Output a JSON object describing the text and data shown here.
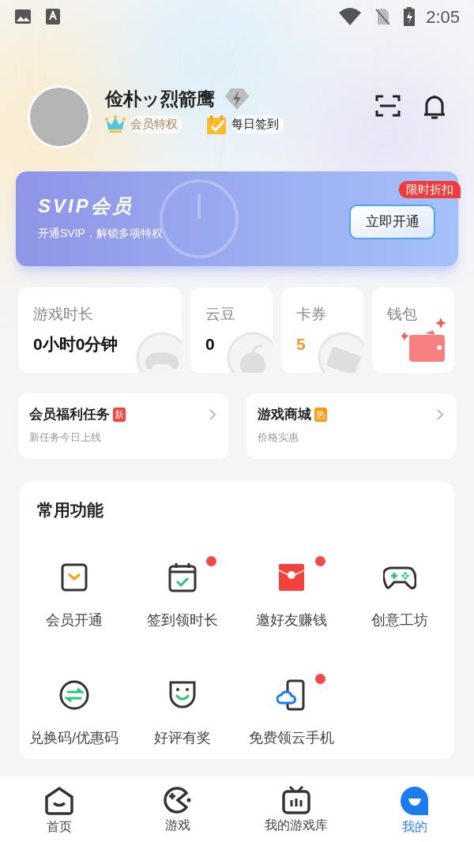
{
  "status_bar": {
    "time": "2:05"
  },
  "profile": {
    "username": "俭朴ッ烈箭鹰",
    "badges": [
      {
        "label": "会员特权"
      },
      {
        "label": "每日签到"
      }
    ]
  },
  "svip_banner": {
    "title": "SVIP会员",
    "subtitle": "开通SVIP，解锁多项特权",
    "tag": "限时折扣",
    "button": "立即开通"
  },
  "stats": [
    {
      "kind": "value",
      "label": "游戏时长",
      "value": "0小时0分钟",
      "highlight": false
    },
    {
      "kind": "value",
      "label": "云豆",
      "value": "0",
      "highlight": false
    },
    {
      "kind": "value",
      "label": "卡券",
      "value": "5",
      "highlight": true
    },
    {
      "kind": "wallet",
      "label": "钱包"
    }
  ],
  "promo_cards": [
    {
      "title": "会员福利任务",
      "tag": "新",
      "color": "#f5413c",
      "subtitle": "新任务今日上线"
    },
    {
      "title": "游戏商城",
      "tag": "热",
      "color": "#fb9a0e",
      "subtitle": "价格实惠"
    }
  ],
  "features": {
    "title": "常用功能",
    "items": [
      {
        "label": "会员开通",
        "dot": false
      },
      {
        "label": "签到领时长",
        "dot": true
      },
      {
        "label": "邀好友赚钱",
        "dot": true
      },
      {
        "label": "创意工坊",
        "dot": false
      },
      {
        "label": "兑换码/优惠码",
        "dot": false
      },
      {
        "label": "好评有奖",
        "dot": false
      },
      {
        "label": "免费领云手机",
        "dot": true
      }
    ]
  },
  "nav": [
    {
      "label": "首页",
      "selected": false
    },
    {
      "label": "游戏",
      "selected": false
    },
    {
      "label": "我的游戏库",
      "selected": false
    },
    {
      "label": "我的",
      "selected": true
    }
  ]
}
